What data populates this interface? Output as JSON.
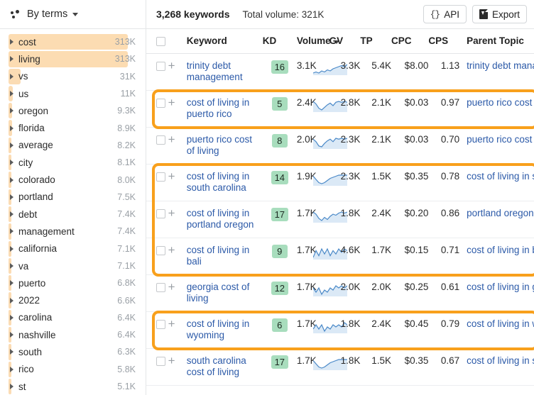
{
  "sidebar": {
    "header": {
      "title": "By terms",
      "icon": "dots-cluster-icon",
      "caret": "chevron-down-icon"
    },
    "max_volume": 313000,
    "items": [
      {
        "label": "cost",
        "volume": "313K",
        "value": 313000,
        "selected": true,
        "depth": 0
      },
      {
        "label": "living",
        "volume": "313K",
        "value": 313000,
        "selected": true,
        "depth": 0
      },
      {
        "label": "vs",
        "volume": "31K",
        "value": 31000,
        "selected": false,
        "depth": 0
      },
      {
        "label": "us",
        "volume": "11K",
        "value": 11000,
        "selected": false,
        "depth": 0
      },
      {
        "label": "oregon",
        "volume": "9.3K",
        "value": 9300,
        "selected": false,
        "depth": 0
      },
      {
        "label": "florida",
        "volume": "8.9K",
        "value": 8900,
        "selected": false,
        "depth": 0
      },
      {
        "label": "average",
        "volume": "8.2K",
        "value": 8200,
        "selected": false,
        "depth": 0
      },
      {
        "label": "city",
        "volume": "8.1K",
        "value": 8100,
        "selected": false,
        "depth": 0
      },
      {
        "label": "colorado",
        "volume": "8.0K",
        "value": 8000,
        "selected": false,
        "depth": 0
      },
      {
        "label": "portland",
        "volume": "7.5K",
        "value": 7500,
        "selected": false,
        "depth": 0
      },
      {
        "label": "debt",
        "volume": "7.4K",
        "value": 7400,
        "selected": false,
        "depth": 0
      },
      {
        "label": "management",
        "volume": "7.4K",
        "value": 7400,
        "selected": false,
        "depth": 0
      },
      {
        "label": "california",
        "volume": "7.1K",
        "value": 7100,
        "selected": false,
        "depth": 0
      },
      {
        "label": "va",
        "volume": "7.1K",
        "value": 7100,
        "selected": false,
        "depth": 0
      },
      {
        "label": "puerto",
        "volume": "6.8K",
        "value": 6800,
        "selected": false,
        "depth": 0
      },
      {
        "label": "2022",
        "volume": "6.6K",
        "value": 6600,
        "selected": false,
        "depth": 0
      },
      {
        "label": "carolina",
        "volume": "6.4K",
        "value": 6400,
        "selected": false,
        "depth": 0
      },
      {
        "label": "nashville",
        "volume": "6.4K",
        "value": 6400,
        "selected": false,
        "depth": 0
      },
      {
        "label": "south",
        "volume": "6.3K",
        "value": 6300,
        "selected": false,
        "depth": 0
      },
      {
        "label": "rico",
        "volume": "5.8K",
        "value": 5800,
        "selected": false,
        "depth": 0
      },
      {
        "label": "st",
        "volume": "5.1K",
        "value": 5100,
        "selected": false,
        "depth": 0
      }
    ]
  },
  "toolbar": {
    "keyword_count": "3,268 keywords",
    "total_volume": "Total volume: 321K",
    "api_label": "API",
    "api_icon": "braces-icon",
    "export_label": "Export",
    "export_icon": "file-download-icon"
  },
  "table": {
    "columns": [
      {
        "key": "keyword",
        "label": "Keyword"
      },
      {
        "key": "kd",
        "label": "KD"
      },
      {
        "key": "volume",
        "label": "Volume",
        "sorted": true,
        "sort_dir": "desc"
      },
      {
        "key": "gv",
        "label": "GV"
      },
      {
        "key": "tp",
        "label": "TP"
      },
      {
        "key": "cpc",
        "label": "CPC"
      },
      {
        "key": "cps",
        "label": "CPS"
      },
      {
        "key": "parent_topic",
        "label": "Parent Topic"
      }
    ],
    "rows": [
      {
        "keyword": "trinity debt management",
        "kd": "16",
        "volume": "3.1K",
        "gv": "3.3K",
        "tp": "5.4K",
        "cpc": "$8.00",
        "cps": "1.13",
        "parent_topic": "trinity debt management",
        "spark": [
          6,
          7,
          6,
          8,
          7,
          9,
          8,
          10,
          11,
          12,
          13,
          12,
          14
        ],
        "highlighted": false
      },
      {
        "keyword": "cost of living in puerto rico",
        "kd": "5",
        "volume": "2.4K",
        "gv": "2.8K",
        "tp": "2.1K",
        "cpc": "$0.03",
        "cps": "0.97",
        "parent_topic": "puerto rico cost of living",
        "spark": [
          13,
          10,
          5,
          3,
          6,
          9,
          11,
          8,
          12,
          13,
          12,
          13,
          12
        ],
        "highlighted": true
      },
      {
        "keyword": "puerto rico cost of living",
        "kd": "8",
        "volume": "2.0K",
        "gv": "2.3K",
        "tp": "2.1K",
        "cpc": "$0.03",
        "cps": "0.70",
        "parent_topic": "puerto rico cost of living",
        "spark": [
          12,
          9,
          4,
          3,
          7,
          10,
          12,
          9,
          13,
          12,
          13,
          12,
          13
        ],
        "highlighted": false
      },
      {
        "keyword": "cost of living in south carolina",
        "kd": "14",
        "volume": "1.9K",
        "gv": "2.3K",
        "tp": "1.5K",
        "cpc": "$0.35",
        "cps": "0.78",
        "parent_topic": "cost of living in south carolina",
        "spark": [
          12,
          9,
          6,
          5,
          6,
          8,
          10,
          11,
          12,
          13,
          13,
          13,
          13
        ],
        "highlighted": true
      },
      {
        "keyword": "cost of living in portland oregon",
        "kd": "17",
        "volume": "1.7K",
        "gv": "1.8K",
        "tp": "2.4K",
        "cpc": "$0.20",
        "cps": "0.86",
        "parent_topic": "portland oregon cost of living",
        "spark": [
          13,
          11,
          7,
          5,
          8,
          6,
          9,
          11,
          10,
          12,
          13,
          12,
          13
        ],
        "highlighted": true
      },
      {
        "keyword": "cost of living in bali",
        "kd": "9",
        "volume": "1.7K",
        "gv": "4.6K",
        "tp": "1.7K",
        "cpc": "$0.15",
        "cps": "0.71",
        "parent_topic": "cost of living in bali",
        "spark": [
          8,
          12,
          9,
          13,
          10,
          13,
          9,
          12,
          10,
          13,
          11,
          13,
          12
        ],
        "highlighted": true
      },
      {
        "keyword": "georgia cost of living",
        "kd": "12",
        "volume": "1.7K",
        "gv": "2.0K",
        "tp": "2.0K",
        "cpc": "$0.25",
        "cps": "0.61",
        "parent_topic": "cost of living in georgia",
        "spark": [
          11,
          9,
          11,
          8,
          10,
          9,
          11,
          10,
          12,
          11,
          12,
          11,
          12
        ],
        "highlighted": false
      },
      {
        "keyword": "cost of living in wyoming",
        "kd": "6",
        "volume": "1.7K",
        "gv": "1.8K",
        "tp": "2.4K",
        "cpc": "$0.45",
        "cps": "0.79",
        "parent_topic": "cost of living in wyoming",
        "spark": [
          10,
          12,
          10,
          12,
          9,
          11,
          10,
          12,
          11,
          12,
          11,
          13,
          12
        ],
        "highlighted": true
      },
      {
        "keyword": "south carolina cost of living",
        "kd": "17",
        "volume": "1.7K",
        "gv": "1.8K",
        "tp": "1.5K",
        "cpc": "$0.35",
        "cps": "0.67",
        "parent_topic": "cost of living in south carolina",
        "spark": [
          12,
          9,
          6,
          5,
          6,
          8,
          10,
          11,
          12,
          13,
          13,
          13,
          13
        ],
        "highlighted": false
      }
    ]
  },
  "colors": {
    "accent_orange": "#f8a01c",
    "term_bar": "#fbdcb4",
    "kd_badge_bg": "#a8ddbd",
    "link_blue": "#2c5aa8",
    "spark_line": "#4a89c8",
    "spark_fill": "#dbe9f6"
  }
}
